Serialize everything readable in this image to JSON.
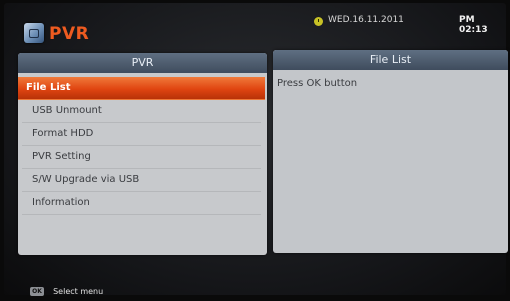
{
  "header": {
    "title": "PVR",
    "logo_icon": "pvr-app-icon",
    "date": "WED.16.11.2011",
    "time": "PM 02:13",
    "title_color": "#ee5b20"
  },
  "left_panel": {
    "title": "PVR",
    "items": [
      {
        "label": "File List",
        "selected": true
      },
      {
        "label": "USB Unmount",
        "selected": false
      },
      {
        "label": "Format HDD",
        "selected": false
      },
      {
        "label": "PVR Setting",
        "selected": false
      },
      {
        "label": "S/W Upgrade via USB",
        "selected": false
      },
      {
        "label": "Information",
        "selected": false
      }
    ],
    "selected_color": "#e04511"
  },
  "right_panel": {
    "title": "File List",
    "message": "Press OK button"
  },
  "footer": {
    "key": "OK",
    "label": "Select menu"
  }
}
